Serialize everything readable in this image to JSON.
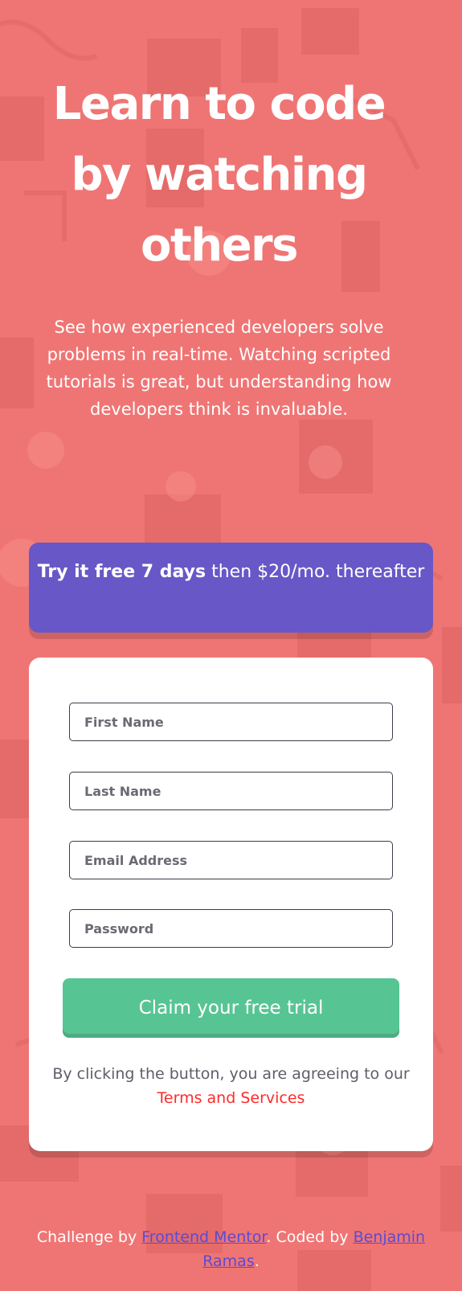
{
  "hero": {
    "title_line1": "Learn to code",
    "title_line2": "by watching",
    "title_line3": "others",
    "description": "See how experienced developers solve problems in real-time. Watching scripted tutorials is great, but understanding how developers think is invaluable."
  },
  "promo": {
    "bold": "Try it free 7 days",
    "rest": " then $20/mo. thereafter"
  },
  "form": {
    "fields": [
      {
        "placeholder": "First Name",
        "value": ""
      },
      {
        "placeholder": "Last Name",
        "value": ""
      },
      {
        "placeholder": "Email Address",
        "value": ""
      },
      {
        "placeholder": "Password",
        "value": ""
      }
    ],
    "button_label": "Claim your free trial",
    "terms_text": "By clicking the button, you are agreeing to our",
    "terms_link": "Terms and Services"
  },
  "footer": {
    "prefix": "Challenge by ",
    "mentor_link": "Frontend Mentor",
    "middle": ". Coded by ",
    "author_link": "Benjamin Ramas",
    "suffix": "."
  },
  "colors": {
    "background": "#ef7574",
    "promo": "#6857c7",
    "button": "#57c593",
    "terms_link": "#ff2a2a",
    "footer_link": "#5b4bd2"
  }
}
